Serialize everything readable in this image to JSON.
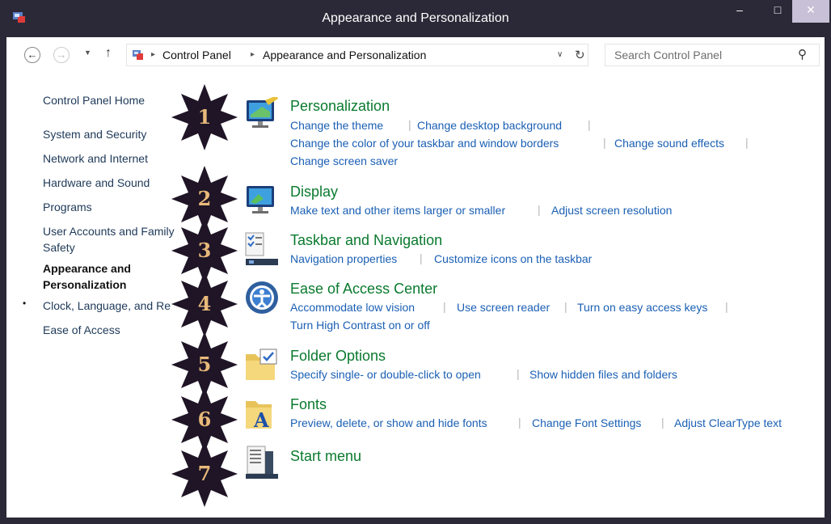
{
  "window": {
    "title": "Appearance and Personalization",
    "minimize": "–",
    "maximize": "□",
    "close": "✕"
  },
  "nav": {
    "back": "←",
    "forward": "→",
    "recent": "▼",
    "up": "↑",
    "breadcrumb": [
      "Control Panel",
      "Appearance and Personalization"
    ],
    "breadcrumb_sep": "▸",
    "address_dropdown": "∨",
    "refresh": "↻"
  },
  "search": {
    "placeholder": "Search Control Panel",
    "icon": "⚲"
  },
  "sidebar": {
    "items": [
      {
        "label": "Control Panel Home"
      },
      {
        "label": "System and Security"
      },
      {
        "label": "Network and Internet"
      },
      {
        "label": "Hardware and Sound"
      },
      {
        "label": "Programs"
      },
      {
        "label": "User Accounts and Family"
      },
      {
        "label": "Safety"
      },
      {
        "label": "Appearance and"
      },
      {
        "label": "Personalization"
      },
      {
        "label": "Clock, Language, and Re"
      },
      {
        "label": "Ease of Access"
      }
    ],
    "bullet": "•"
  },
  "categories": [
    {
      "title": "Personalization",
      "icon": "personalization-icon",
      "tasks": [
        "Change the theme",
        "Change desktop background",
        "Change the color of your taskbar and window borders",
        "Change sound effects",
        "Change screen saver"
      ]
    },
    {
      "title": "Display",
      "icon": "display-icon",
      "tasks": [
        "Make text and other items larger or smaller",
        "Adjust screen resolution"
      ]
    },
    {
      "title": "Taskbar and Navigation",
      "icon": "taskbar-icon",
      "tasks": [
        "Navigation properties",
        "Customize icons on the taskbar"
      ]
    },
    {
      "title": "Ease of Access Center",
      "icon": "ease-of-access-icon",
      "tasks": [
        "Accommodate low vision",
        "Use screen reader",
        "Turn on easy access keys",
        "Turn High Contrast on or off"
      ]
    },
    {
      "title": "Folder Options",
      "icon": "folder-options-icon",
      "tasks": [
        "Specify single- or double-click to open",
        "Show hidden files and folders"
      ]
    },
    {
      "title": "Fonts",
      "icon": "fonts-icon",
      "tasks": [
        "Preview, delete, or show and hide fonts",
        "Change Font Settings",
        "Adjust ClearType text"
      ]
    },
    {
      "title": "Start menu",
      "icon": "start-menu-icon",
      "tasks": []
    }
  ],
  "markers": [
    "1",
    "2",
    "3",
    "4",
    "5",
    "6",
    "7"
  ],
  "colors": {
    "frame": "#2b2937",
    "category_title": "#0a7a2e",
    "task_link": "#1a5fb4",
    "marker_fill": "#1f1526",
    "marker_text": "#e8b97a"
  }
}
